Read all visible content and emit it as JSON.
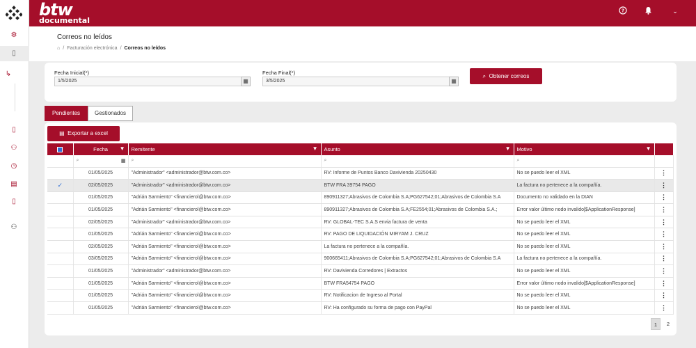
{
  "brand": {
    "top": "btw",
    "bottom": "documental"
  },
  "header": {
    "help_icon": "help-circle-icon",
    "bell_icon": "bell-icon",
    "menu_icon": "chevron-down-icon"
  },
  "page": {
    "title": "Correos no leídos",
    "breadcrumb": [
      "Facturación electrónica",
      "Correos no leídos"
    ]
  },
  "filters": {
    "start_label": "Fecha Inicial(*)",
    "start_value": "1/5/2025",
    "end_label": "Fecha Final(*)",
    "end_value": "3/5/2025",
    "fetch_button": "Obtener correos"
  },
  "tabs": [
    {
      "label": "Pendientes",
      "active": true
    },
    {
      "label": "Gestionados",
      "active": false
    }
  ],
  "export_button": "Exportar a excel",
  "table": {
    "columns": [
      "Fecha",
      "Remitente",
      "Asunto",
      "Motivo"
    ],
    "rows": [
      {
        "fecha": "01/05/2025",
        "remitente": "\"Administrador\" <administrador@btw.com.co>",
        "asunto": "RV: Informe de Puntos Banco Davivienda 20250430",
        "motivo": "No se puedo leer el XML",
        "checked": false
      },
      {
        "fecha": "02/05/2025",
        "remitente": "\"Administrador\" <administrador@btw.com.co>",
        "asunto": "BTW FRA 39754 PAGO",
        "motivo": "La factura no pertenece a la compañía.",
        "checked": true
      },
      {
        "fecha": "01/05/2025",
        "remitente": "\"Adrián Sarmiento\" <financierol@btw.com.co>",
        "asunto": "890911327;Abrasivos de Colombia S.A;PG627542;01;Abrasivos de Colombia S.A",
        "motivo": "Documento no validado en la DIAN",
        "checked": false
      },
      {
        "fecha": "01/05/2025",
        "remitente": "\"Adrián Sarmiento\" <financierol@btw.com.co>",
        "asunto": "890911327;Abrasivos de Colombia S.A;FE2554;01;Abrasivos de Colombia S.A.;",
        "motivo": "Error valor último nodo invalido[$ApplicationResponse]",
        "checked": false
      },
      {
        "fecha": "02/05/2025",
        "remitente": "\"Administrador\" <administrador@btw.com.co>",
        "asunto": "RV: GLOBAL-TEC S.A.S envia factura de venta",
        "motivo": "No se puedo leer el XML",
        "checked": false
      },
      {
        "fecha": "01/05/2025",
        "remitente": "\"Adrián Sarmiento\" <financierol@btw.com.co>",
        "asunto": "RV: PAGO DE LIQUIDACIÓN MIRYAM J. CRUZ",
        "motivo": "No se puedo leer el XML",
        "checked": false
      },
      {
        "fecha": "02/05/2025",
        "remitente": "\"Adrián Sarmiento\" <financierol@btw.com.co>",
        "asunto": "La factura no pertenece a la compañía.",
        "motivo": "No se puedo leer el XML",
        "checked": false
      },
      {
        "fecha": "03/05/2025",
        "remitente": "\"Adrián Sarmiento\" <financierol@btw.com.co>",
        "asunto": "900665411;Abrasivos de Colombia S.A;PG627542;01;Abrasivos de Colombia S.A",
        "motivo": "La factura no pertenece a la compañía.",
        "checked": false
      },
      {
        "fecha": "01/05/2025",
        "remitente": "\"Administrador\" <administrador@btw.com.co>",
        "asunto": "RV: Davivienda Corredores | Extractos",
        "motivo": "No se puedo leer el XML",
        "checked": false
      },
      {
        "fecha": "01/05/2025",
        "remitente": "\"Adrián Sarmiento\" <financierol@btw.com.co>",
        "asunto": "BTW FRA54754 PAGO",
        "motivo": "Error valor último nodo invalido[$ApplicationResponse]",
        "checked": false
      },
      {
        "fecha": "01/05/2025",
        "remitente": "\"Adrián Sarmiento\" <financierol@btw.com.co>",
        "asunto": "RV: Notificacion de Ingreso al Portal",
        "motivo": "No se puedo leer el XML",
        "checked": false
      },
      {
        "fecha": "01/05/2025",
        "remitente": "\"Adrián Sarmiento\" <financierol@btw.com.co>",
        "asunto": "RV: Ha configurado su forma de pago con PayPal",
        "motivo": "No se puedo leer el XML",
        "checked": false
      }
    ]
  },
  "pagination": {
    "pages": [
      "1",
      "2"
    ],
    "current": "1"
  },
  "colors": {
    "brand": "#a50e2a",
    "checkbox": "#2f6fd6"
  }
}
